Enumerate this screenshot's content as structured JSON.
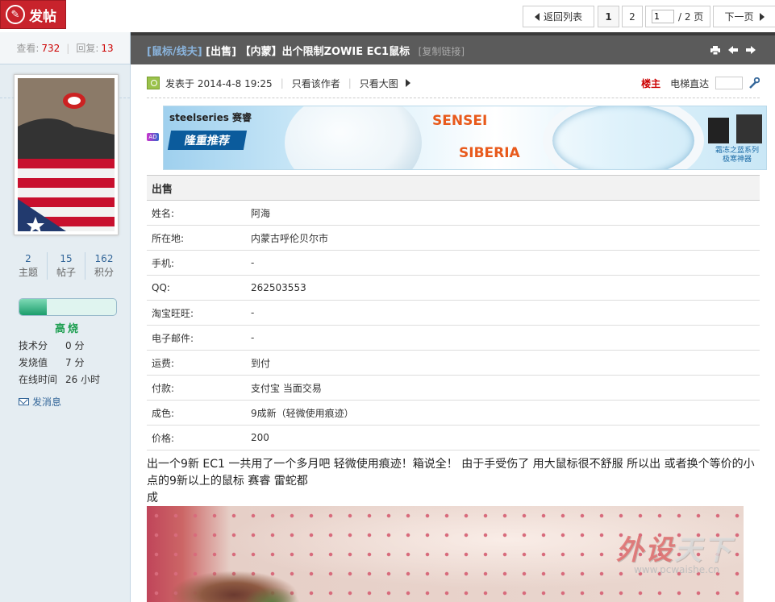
{
  "toolbar": {
    "post_label": "发帖",
    "back_label": "返回列表",
    "pages": [
      "1",
      "2"
    ],
    "page_input_value": "1",
    "page_total": "/ 2 页",
    "next_label": "下一页"
  },
  "sidebar": {
    "views_label": "查看:",
    "views": "732",
    "replies_label": "回复:",
    "replies": "13",
    "author": "阿海",
    "counts": [
      {
        "value": "2",
        "label": "主题"
      },
      {
        "value": "15",
        "label": "帖子"
      },
      {
        "value": "162",
        "label": "积分"
      }
    ],
    "level_progress": 0.28,
    "level_name": "高烧",
    "attrs": [
      {
        "key": "技术分",
        "value": "0 分"
      },
      {
        "key": "发烧值",
        "value": "7 分"
      },
      {
        "key": "在线时间",
        "value": "26 小时"
      }
    ],
    "send_message": "发消息"
  },
  "thread": {
    "category": "[鼠标/线夫]",
    "title": " [出售] 【内蒙】出个限制ZOWIE EC1鼠标",
    "copy_link": "[复制链接]"
  },
  "post": {
    "posted_at": "发表于  2014-4-8 19:25",
    "only_author": "只看该作者",
    "large_image": "只看大图",
    "floor_label": "楼主",
    "elevator_label": "电梯直达"
  },
  "ad": {
    "tag": "AD",
    "brand": "steelseries 赛睿",
    "promo": "隆重推荐",
    "product1": "SENSEI",
    "product2": "SIBERIA",
    "slogan_line1": "霜冻之蓝系列",
    "slogan_line2": "极寒神器"
  },
  "info_table": {
    "header": "出售",
    "rows": [
      {
        "key": "姓名:",
        "value": "阿海"
      },
      {
        "key": "所在地:",
        "value": "内蒙古呼伦贝尔市"
      },
      {
        "key": "手机:",
        "value": "-"
      },
      {
        "key": "QQ:",
        "value": "262503553"
      },
      {
        "key": "淘宝旺旺:",
        "value": "-"
      },
      {
        "key": "电子邮件:",
        "value": "-"
      },
      {
        "key": "运费:",
        "value": "到付"
      },
      {
        "key": "付款:",
        "value": "支付宝 当面交易"
      },
      {
        "key": "成色:",
        "value": "9成新（轻微使用痕迹）"
      },
      {
        "key": "价格:",
        "value": "200"
      }
    ]
  },
  "message": {
    "line1": "出一个9新  EC1  一共用了一个多月吧  轻微使用痕迹！箱说全！  由于手受伤了  用大鼠标很不舒服  所以出  或者换个等价的小点的9新以上的鼠标  赛睿  雷蛇都",
    "line2": "成"
  },
  "watermark": {
    "text_a": "外设",
    "text_b": "天下",
    "url": "www.pcwaishe.cn"
  },
  "colors": {
    "post_button": "#c8232c",
    "titlebar": "#5b5b5b",
    "floor_label": "#cc0000",
    "level_name": "#1c9e50"
  }
}
